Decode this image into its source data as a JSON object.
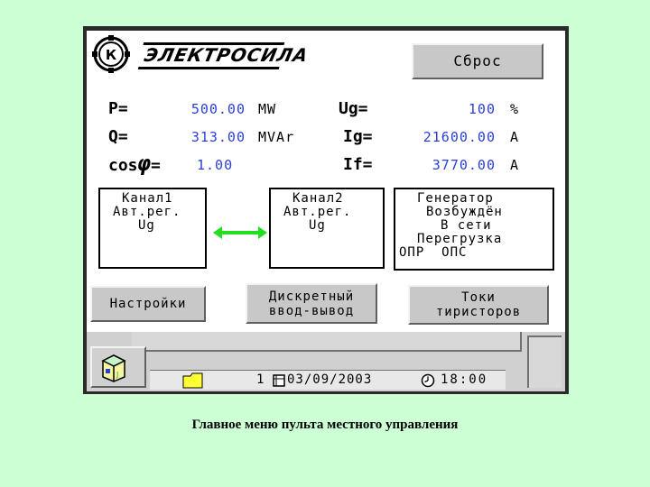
{
  "header": {
    "logo_text": "ЭЛЕКТРОСИЛА",
    "reset_label": "Сброс"
  },
  "readings": {
    "p": {
      "label": "P=",
      "value": "500.00",
      "unit": "MW"
    },
    "q": {
      "label": "Q=",
      "value": "313.00",
      "unit": "MVAr"
    },
    "cos": {
      "label": "cos",
      "phi": "φ",
      "eq": "=",
      "value": "1.00"
    },
    "ug": {
      "label": "Ug=",
      "value": "100",
      "unit": "%"
    },
    "ig": {
      "label": "Ig=",
      "value": "21600.00",
      "unit": "A"
    },
    "if": {
      "label": "If=",
      "value": "3770.00",
      "unit": "A"
    }
  },
  "channel1": {
    "line1": "Канал1",
    "line2": "Авт.рег.",
    "line3": "Ug"
  },
  "channel2": {
    "line1": "Канал2",
    "line2": "Авт.рег.",
    "line3": "Ug"
  },
  "generator": {
    "line1": "Генератор",
    "line2": "Возбуждён",
    "line3": "В сети",
    "line4": "Перегрузка",
    "opr": "ОПР",
    "ops": "ОПС"
  },
  "buttons": {
    "settings": "Настройки",
    "discrete_1": "Дискретный",
    "discrete_2": "ввод-вывод",
    "currents_1": "Токи",
    "currents_2": "тиристоров"
  },
  "status": {
    "page": "1",
    "date": "03/09/2003",
    "time": "18:00"
  },
  "colors": {
    "background": "#ccffd4",
    "value_blue": "#2a3fd8",
    "arrow_green": "#22dd22",
    "button_gray": "#c8c8c8"
  },
  "icons": [
    "brand-emblem-icon",
    "double-arrow-icon",
    "app-cube-icon",
    "folder-icon",
    "calendar-icon",
    "clock-icon"
  ],
  "caption": "Главное меню пульта местного управления"
}
